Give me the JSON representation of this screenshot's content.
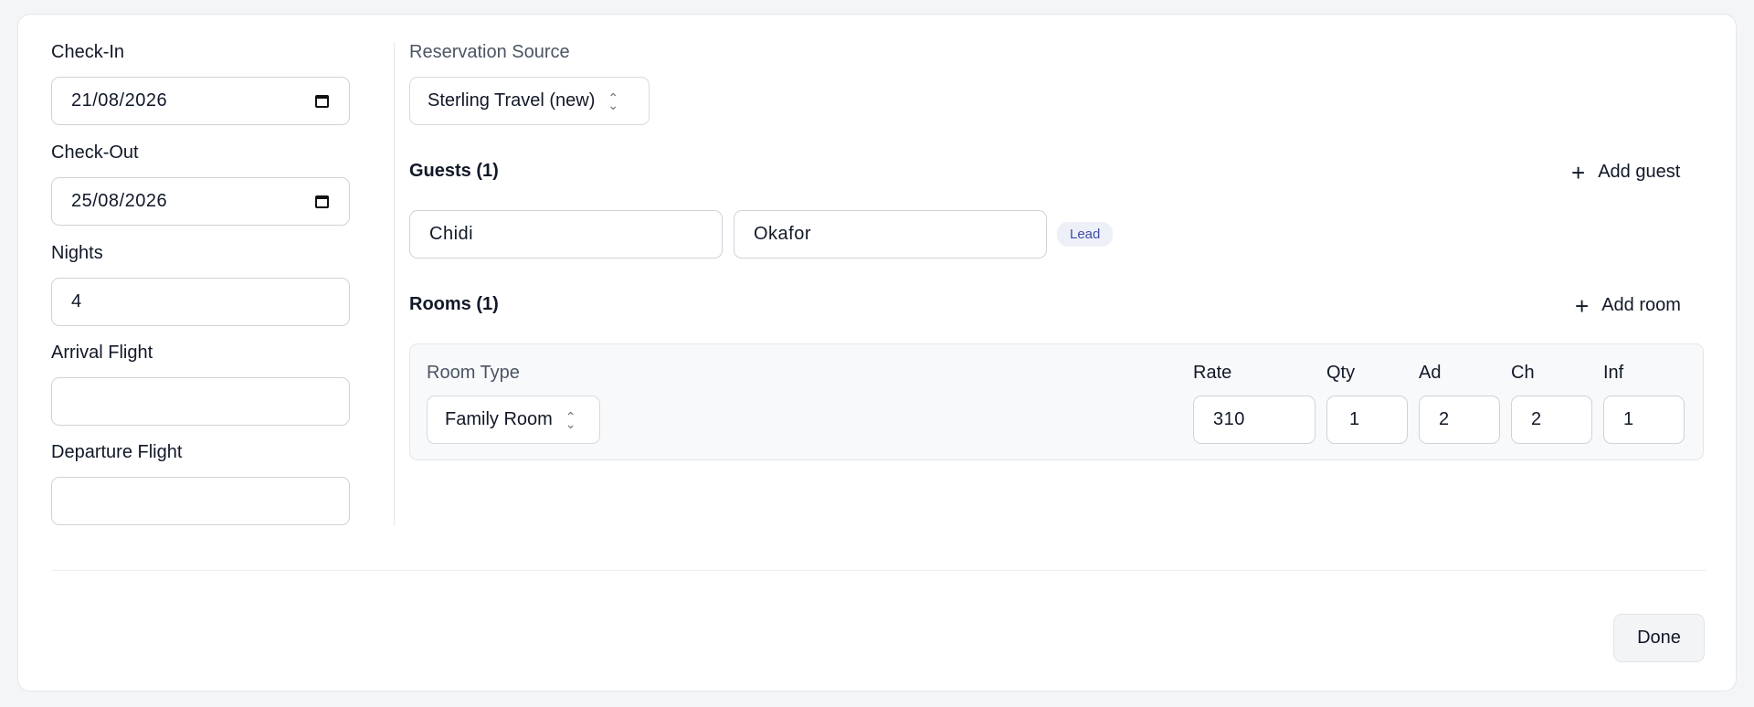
{
  "left": {
    "check_in": {
      "label": "Check-In",
      "value": "21/08/2026"
    },
    "check_out": {
      "label": "Check-Out",
      "value": "25/08/2026"
    },
    "nights": {
      "label": "Nights",
      "value": "4"
    },
    "arrival_flight": {
      "label": "Arrival Flight",
      "value": ""
    },
    "departure_flight": {
      "label": "Departure Flight",
      "value": ""
    }
  },
  "reservation_source": {
    "label": "Reservation Source",
    "value": "Sterling Travel (new)"
  },
  "guests": {
    "heading": "Guests (1)",
    "add_label": "Add guest",
    "items": [
      {
        "first_name": "Chidi",
        "last_name": "Okafor",
        "badge": "Lead"
      }
    ]
  },
  "rooms": {
    "heading": "Rooms (1)",
    "add_label": "Add room",
    "columns": {
      "room_type": "Room Type",
      "rate": "Rate",
      "qty": "Qty",
      "ad": "Ad",
      "ch": "Ch",
      "inf": "Inf"
    },
    "items": [
      {
        "room_type": "Family Room",
        "rate": "310",
        "qty": "1",
        "ad": "2",
        "ch": "2",
        "inf": "1"
      }
    ]
  },
  "footer": {
    "done_label": "Done"
  },
  "icons": {
    "calendar": "calendar-icon",
    "chevron": "chevron-updown-icon",
    "plus": "plus-icon"
  }
}
